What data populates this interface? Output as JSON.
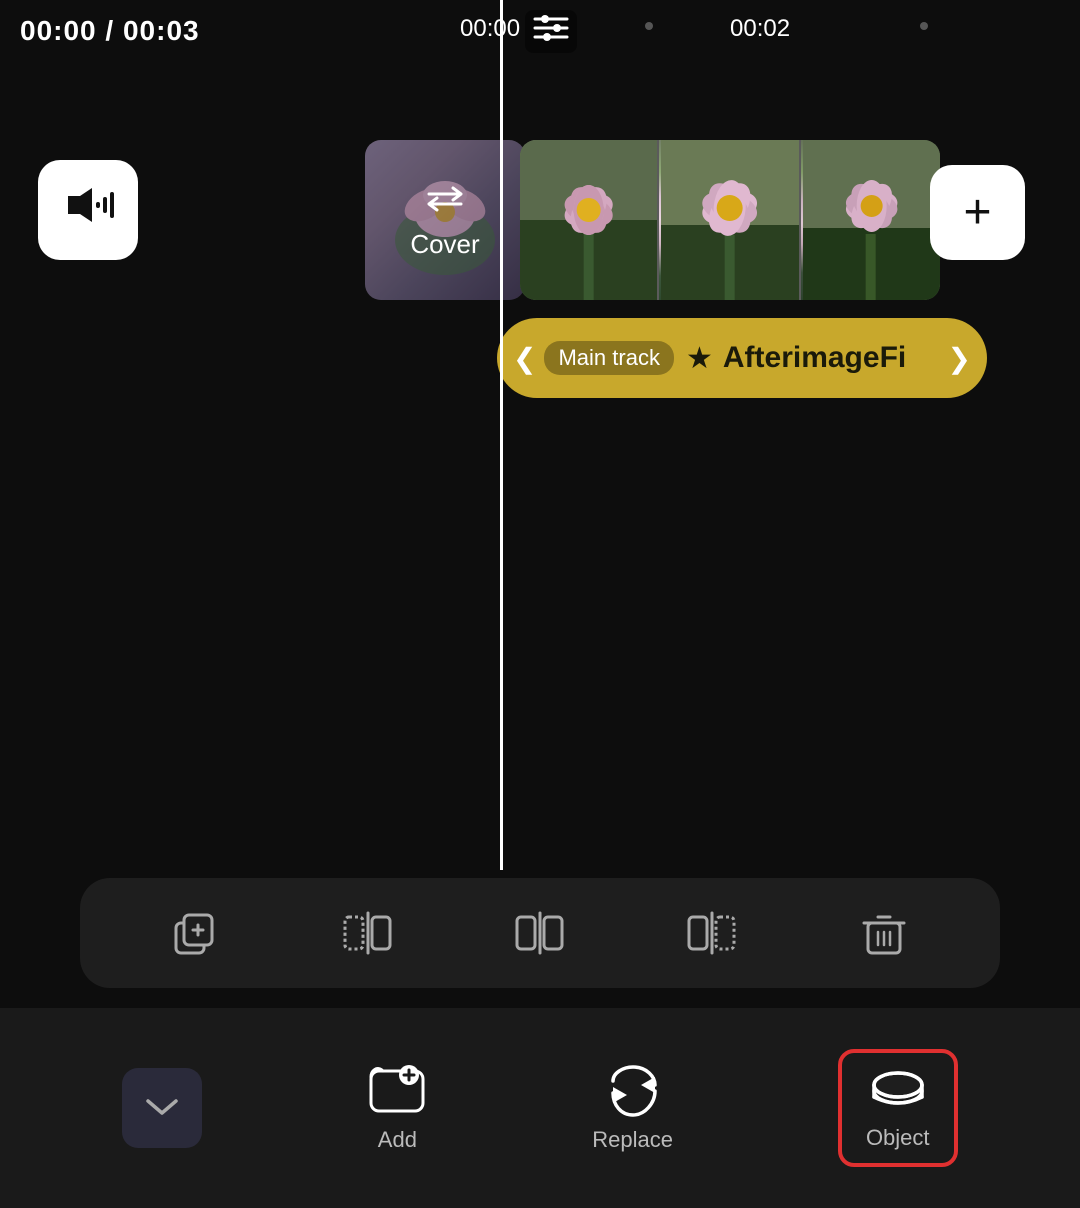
{
  "header": {
    "time_current": "00:00",
    "time_separator": "/",
    "time_total": "00:03",
    "marker_00": "00:00",
    "marker_02": "00:02"
  },
  "volume_button": {
    "icon": "🔊",
    "aria": "volume"
  },
  "cover": {
    "label": "Cover",
    "swap_icon": "⇄"
  },
  "add_button": {
    "label": "+"
  },
  "main_track": {
    "badge": "Main track",
    "star": "★",
    "name": "AfterimageFi",
    "arrow_left": "❮",
    "arrow_right": "❯"
  },
  "toolbar": {
    "btn1_icon": "⊞",
    "btn2_icon": "⠿",
    "btn3_icon": "⊡",
    "btn4_icon": "⊞",
    "btn5_icon": "🗑"
  },
  "bottom_bar": {
    "collapse_icon": "∨",
    "add_label": "Add",
    "replace_label": "Replace",
    "object_label": "Object"
  }
}
